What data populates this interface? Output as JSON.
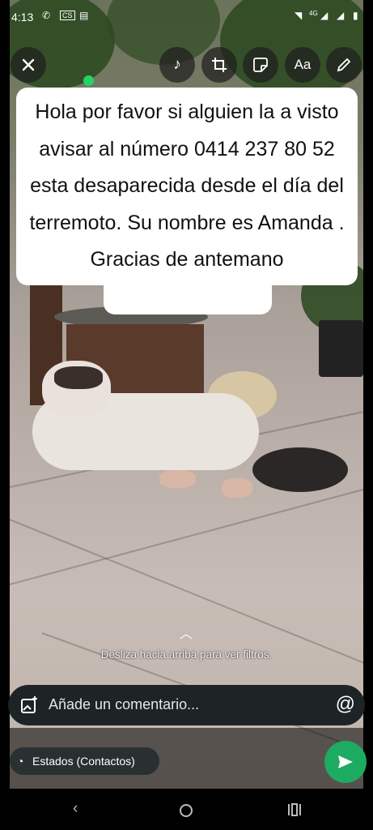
{
  "status_bar": {
    "time": "4:13",
    "icons": [
      "whatsapp-icon",
      "cs-icon",
      "calendar-icon",
      "wifi-icon",
      "signal-icon",
      "signal-icon",
      "battery-icon"
    ],
    "cs_label": "CS",
    "network_label": "4G"
  },
  "toolbar": {
    "close_icon": "close-icon",
    "tools": [
      "music-icon",
      "crop-rotate-icon",
      "sticker-icon",
      "text-icon",
      "pencil-icon"
    ],
    "text_tool_label": "Aa"
  },
  "caption": {
    "text": "Hola por favor si alguien la  a visto avisar al número 0414 237 80 52 esta desaparecida desde el día del terremoto.  Su nombre es Amanda . Gracias de antemano"
  },
  "filters_hint": {
    "text": "Desliza hacia arriba para ver filtros.",
    "icon": "chevron-up-icon"
  },
  "comment": {
    "placeholder": "Añade un comentario...",
    "mention_icon": "at-icon",
    "media_icon": "add-media-icon"
  },
  "audience": {
    "label": "Estados (Contactos)",
    "icon": "status-icon"
  },
  "send_button": {
    "icon": "send-icon",
    "color": "#1daa61"
  },
  "navigation": {
    "buttons": [
      "back-icon",
      "home-icon",
      "recents-icon"
    ]
  },
  "colors": {
    "accent": "#25d366",
    "send": "#1daa61",
    "input_bg": "#1e2326"
  }
}
